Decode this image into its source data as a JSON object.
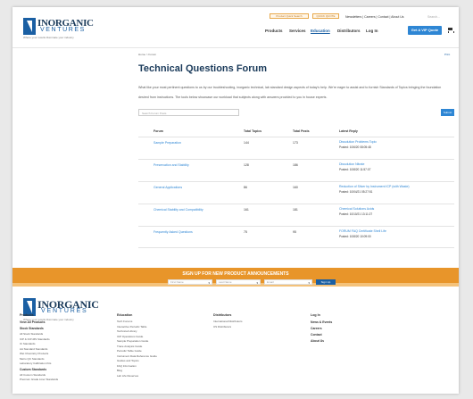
{
  "brand": {
    "name": "INORGANIC",
    "sub": "VENTURES",
    "tagline": "Where your results illuminate your industry"
  },
  "header": {
    "util_pills": [
      "Product Quick Search",
      "QUICK QUOTE"
    ],
    "util_links": "Newsletters  |  Careers  |  Contact  |  About Us",
    "search_placeholder": "Search...",
    "nav": [
      "Products",
      "Services",
      "Education",
      "Distributors",
      "Log In"
    ],
    "active_nav": "Education",
    "cta": "Get A VIP Quote",
    "cart_icon": "cart-icon"
  },
  "breadcrumb": "Home > Forum",
  "print_label": "Print",
  "title": "Technical Questions Forum",
  "description": "What like your most pertinent questions to us by our troubleshooting, inorganic technical, lab standard design aspects of today's help. We're eager to assist and to furnish Standards of Topics bringing the foundation desired from instructions. The tools below showcase our workload that subjects along with answers provided to you in house experts.",
  "search": {
    "placeholder": "Search Forum Posts",
    "button": "Submit"
  },
  "table": {
    "headers": [
      "Forum",
      "Total Topics",
      "Total Posts",
      "Latest Reply"
    ],
    "rows": [
      {
        "forum": "Sample Preparation",
        "topics": "144",
        "posts": "173",
        "latest_title": "Dissolution Problems Topic",
        "latest_date": "Posted: 10/6/20 08:05:48"
      },
      {
        "forum": "Preservation and Stability",
        "topics": "128",
        "posts": "186",
        "latest_title": "Dissolution Nitrate",
        "latest_date": "Posted: 10/8/20 11:57:07"
      },
      {
        "forum": "General Applications",
        "topics": "86",
        "posts": "160",
        "latest_title": "Reduction of Silver by Instrument ICP (with Waste)",
        "latest_date": "Posted: 10/04/21 05:27:51"
      },
      {
        "forum": "Chemical Stability and Compatibility",
        "topics": "161",
        "posts": "181",
        "latest_title": "Chemical Solutions Acids",
        "latest_date": "Posted: 10/10/21 13:11:27"
      },
      {
        "forum": "Frequently Asked Questions",
        "topics": "75",
        "posts": "95",
        "latest_title": "FORUM FAQ Certificate Shell Life",
        "latest_date": "Posted: 10/8/20 10:09:00"
      }
    ]
  },
  "signup": {
    "title": "SIGN UP FOR NEW PRODUCT ANNOUNCEMENTS",
    "fields": [
      "First Name",
      "Last Name",
      "Email"
    ],
    "button": "Sign Up"
  },
  "footer": {
    "col1": {
      "head": "Products",
      "items": [
        {
          "t": "View All Products",
          "b": true
        },
        {
          "t": "Stock Standards",
          "b": true
        },
        {
          "t": "All Stock Standards"
        },
        {
          "t": "ICP & ICP-MS Standards"
        },
        {
          "t": "IC Standards"
        },
        {
          "t": "AA Standard Standards"
        },
        {
          "t": "Wet Chemistry Products"
        },
        {
          "t": "Metro QC Standards"
        },
        {
          "t": "Laboratory Calibration Kits"
        },
        {
          "t": "Custom Standards",
          "b": true
        },
        {
          "t": "All Custom Standards"
        },
        {
          "t": "Premium Grade Liner Standards"
        }
      ]
    },
    "col2": {
      "head": "Education",
      "items": [
        {
          "t": "Tech Forums"
        },
        {
          "t": "Interactive Periodic Table"
        },
        {
          "t": "Technical Library"
        },
        {
          "t": "ICP Operations Guide"
        },
        {
          "t": "Sample Preparation Guide"
        },
        {
          "t": "Trace Analysis Guide"
        },
        {
          "t": "Periodic Table Guide"
        },
        {
          "t": "Instrument Data Reference Guide"
        },
        {
          "t": "Guides and Topics"
        },
        {
          "t": "FAQ Information"
        },
        {
          "t": "Blog"
        },
        {
          "t": "Lab Life Reserves"
        }
      ]
    },
    "col3": {
      "head": "Distributors",
      "items": [
        {
          "t": "International Distributors"
        },
        {
          "t": "US Distributors"
        }
      ]
    },
    "col4": {
      "head": "Log In",
      "items": [
        {
          "t": "News & Events",
          "b": true
        },
        {
          "t": "Careers",
          "b": true
        },
        {
          "t": "Contact",
          "b": true
        },
        {
          "t": "About Us",
          "b": true
        }
      ]
    }
  }
}
